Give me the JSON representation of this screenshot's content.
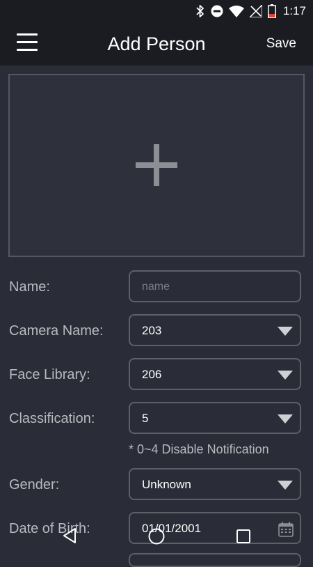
{
  "status_bar": {
    "time": "1:17"
  },
  "app_bar": {
    "title": "Add Person",
    "save_label": "Save"
  },
  "form": {
    "name": {
      "label": "Name:",
      "placeholder": "name",
      "value": ""
    },
    "camera_name": {
      "label": "Camera Name:",
      "value": "203"
    },
    "face_library": {
      "label": "Face Library:",
      "value": "206"
    },
    "classification": {
      "label": "Classification:",
      "value": "5",
      "note": "* 0~4 Disable Notification"
    },
    "gender": {
      "label": "Gender:",
      "value": "Unknown"
    },
    "date_of_birth": {
      "label": "Date of Birth:",
      "value": "01/01/2001"
    }
  },
  "icons": {
    "status": [
      "bluetooth-icon",
      "do-not-disturb-icon",
      "wifi-icon",
      "no-signal-icon",
      "battery-low-icon"
    ],
    "nav": [
      "back-icon",
      "home-icon",
      "recents-icon"
    ]
  },
  "colors": {
    "background": "#2a2c37",
    "app_bar": "#1b1c22",
    "field_border": "#5d6069",
    "battery_low": "#e2452f"
  }
}
